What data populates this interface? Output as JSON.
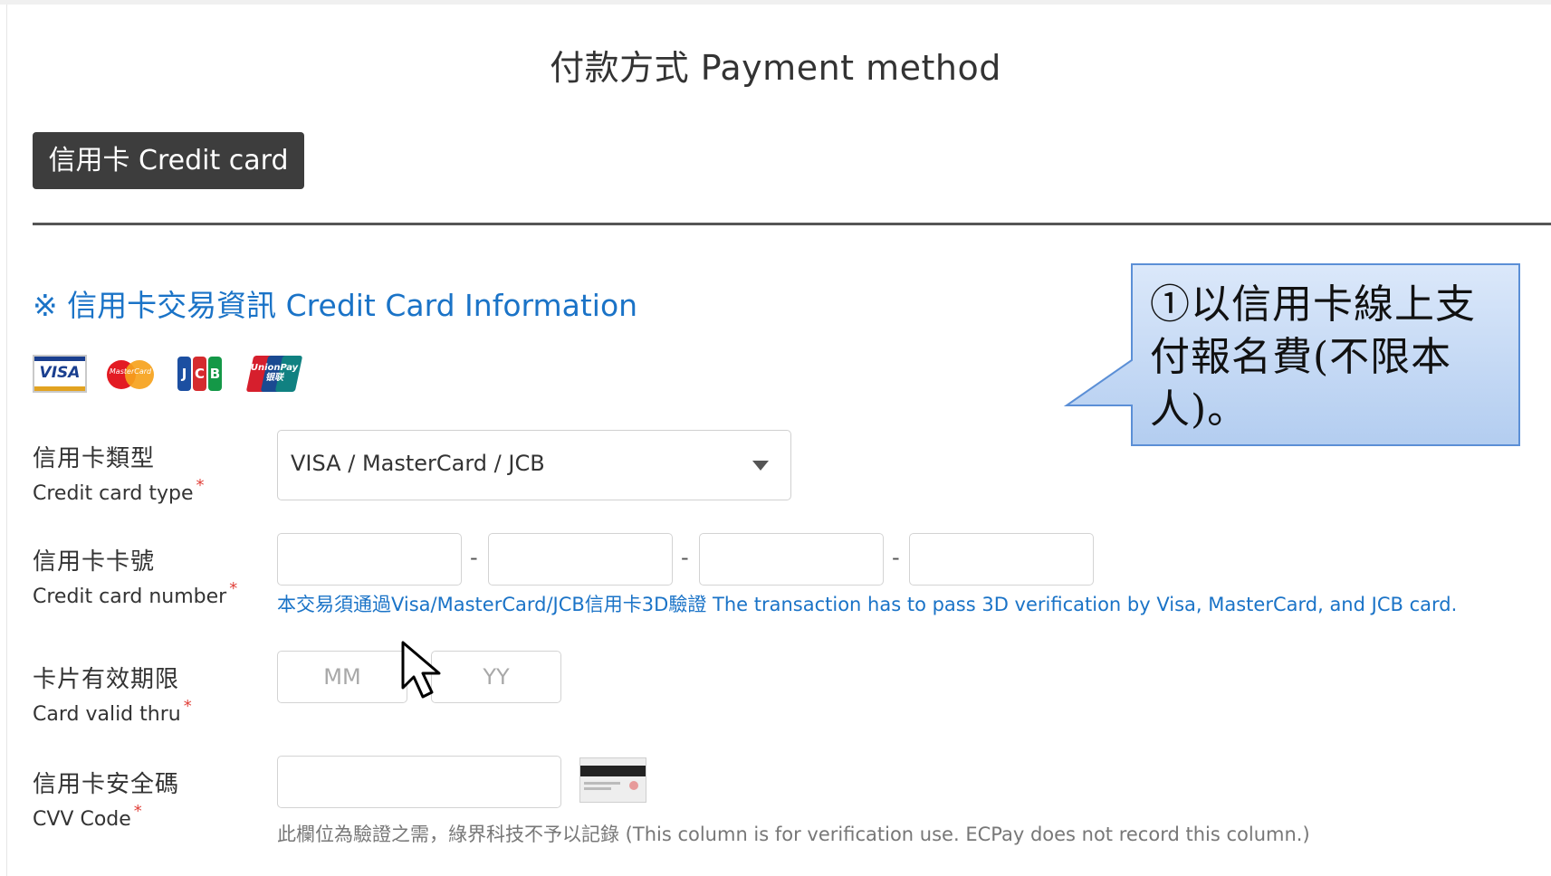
{
  "header": {
    "title": "付款方式 Payment method"
  },
  "tabs": [
    {
      "label": "信用卡 Credit card",
      "active": true
    }
  ],
  "section": {
    "title": "※ 信用卡交易資訊 Credit Card Information",
    "accent_color": "#1a73c7"
  },
  "card_logos": [
    {
      "name": "visa-logo",
      "text": "VISA"
    },
    {
      "name": "mastercard-logo",
      "text": "MasterCard"
    },
    {
      "name": "jcb-logo",
      "text": "JCB"
    },
    {
      "name": "unionpay-logo",
      "text": "UnionPay 银联"
    }
  ],
  "form": {
    "card_type": {
      "label_zh": "信用卡類型",
      "label_en": "Credit card type",
      "required_mark": "*",
      "selected": "VISA / MasterCard / JCB"
    },
    "card_number": {
      "label_zh": "信用卡卡號",
      "label_en": "Credit card number",
      "required_mark": "*",
      "separator": "-",
      "segments": [
        "",
        "",
        "",
        ""
      ],
      "note": "本交易須通過Visa/MasterCard/JCB信用卡3D驗證 The transaction has to pass 3D verification by Visa, MasterCard, and JCB card."
    },
    "valid_thru": {
      "label_zh": "卡片有效期限",
      "label_en": "Card valid thru",
      "required_mark": "*",
      "month_placeholder": "MM",
      "year_placeholder": "YY"
    },
    "cvv": {
      "label_zh": "信用卡安全碼",
      "label_en": "CVV Code",
      "required_mark": "*",
      "value": "",
      "note": "此欄位為驗證之需，綠界科技不予以記錄 (This column is for verification use. ECPay does not record this column.)"
    }
  },
  "callout": {
    "text": "①以信用卡線上支付報名費(不限本人)。"
  },
  "colors": {
    "tab_bg": "#3d3d3d",
    "link_blue": "#1a73c7",
    "required_red": "#e0413a",
    "callout_fill": "#c9dbf5",
    "callout_border": "#5b8fd6"
  }
}
